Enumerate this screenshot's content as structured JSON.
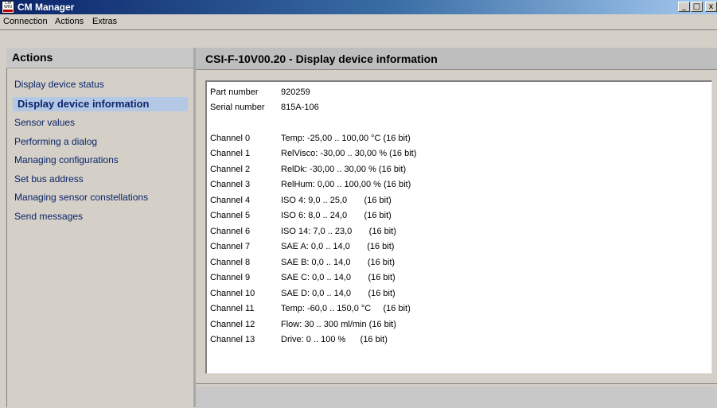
{
  "window": {
    "title": "CM Manager",
    "icon_text": "CM WIN",
    "controls": {
      "minimize": "_",
      "maximize": "□",
      "close": "x"
    }
  },
  "menubar": {
    "items": [
      "Connection",
      "Actions",
      "Extras"
    ]
  },
  "sidebar": {
    "header": "Actions",
    "items": [
      {
        "label": "Display device status",
        "active": false
      },
      {
        "label": "Display device information",
        "active": true
      },
      {
        "label": "Sensor values",
        "active": false
      },
      {
        "label": "Performing a dialog",
        "active": false
      },
      {
        "label": "Managing configurations",
        "active": false
      },
      {
        "label": "Set bus address",
        "active": false
      },
      {
        "label": "Managing sensor constellations",
        "active": false
      },
      {
        "label": "Send messages",
        "active": false
      }
    ]
  },
  "main": {
    "header": "CSI-F-10V00.20 - Display device information",
    "part_number_label": "Part number",
    "part_number": "920259",
    "serial_number_label": "Serial number",
    "serial_number": "815A-106",
    "channels": [
      {
        "label": "Channel 0",
        "value": "Temp: -25,00 .. 100,00 °C (16 bit)"
      },
      {
        "label": "Channel 1",
        "value": "RelVisco: -30,00 .. 30,00 % (16 bit)"
      },
      {
        "label": "Channel 2",
        "value": "RelDk: -30,00 .. 30,00 % (16 bit)"
      },
      {
        "label": "Channel 3",
        "value": "RelHum: 0,00 .. 100,00 % (16 bit)"
      },
      {
        "label": "Channel 4",
        "value": "ISO 4: 9,0 .. 25,0       (16 bit)"
      },
      {
        "label": "Channel 5",
        "value": "ISO 6: 8,0 .. 24,0       (16 bit)"
      },
      {
        "label": "Channel 6",
        "value": "ISO 14: 7,0 .. 23,0       (16 bit)"
      },
      {
        "label": "Channel 7",
        "value": "SAE A: 0,0 .. 14,0       (16 bit)"
      },
      {
        "label": "Channel 8",
        "value": "SAE B: 0,0 .. 14,0       (16 bit)"
      },
      {
        "label": "Channel 9",
        "value": "SAE C: 0,0 .. 14,0       (16 bit)"
      },
      {
        "label": "Channel 10",
        "value": "SAE D: 0,0 .. 14,0       (16 bit)"
      },
      {
        "label": "Channel 11",
        "value": "Temp: -60,0 .. 150,0 °C     (16 bit)"
      },
      {
        "label": "Channel 12",
        "value": "Flow: 30 .. 300 ml/min (16 bit)"
      },
      {
        "label": "Channel 13",
        "value": "Drive: 0 .. 100 %      (16 bit)"
      }
    ]
  },
  "colors": {
    "titlebar_start": "#0a246a",
    "titlebar_end": "#a6caf0",
    "nav_text": "#0a246a",
    "nav_active_bg": "#b4c8e6",
    "panel_bg": "#d4d0c8"
  }
}
